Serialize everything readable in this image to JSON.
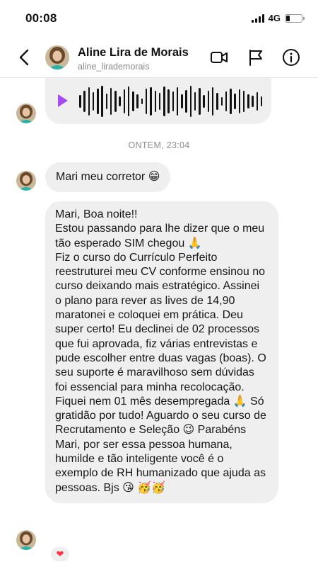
{
  "status_bar": {
    "time": "00:08",
    "network": "4G"
  },
  "header": {
    "contact_name": "Aline Lira de Morais",
    "username": "aline_lirademorais"
  },
  "conversation": {
    "timestamp": "ONTEM, 23:04",
    "messages": [
      {
        "kind": "voice"
      },
      {
        "kind": "text",
        "text": "Mari meu corretor 😁"
      },
      {
        "kind": "text",
        "text": "Mari, Boa noite!!\nEstou passando para lhe dizer que o meu tão esperado SIM chegou 🙏\nFiz o curso do Currículo Perfeito reestruturei meu CV conforme ensinou no curso deixando mais estratégico. Assinei o plano para rever as lives de 14,90 maratonei e coloquei em prática. Deu super certo! Eu declinei de 02 processos que fui aprovada, fiz várias entrevistas e pude escolher entre duas vagas (boas). O seu suporte é maravilhoso sem dúvidas foi essencial para minha recolocação. Fiquei nem 01 mês desempregada 🙏 Só gratidão por tudo! Aguardo o seu curso de Recrutamento e Seleção 😉 Parabéns Mari, por ser essa pessoa humana, humilde e tão inteligente você é o exemplo de RH humanizado que ajuda as pessoas. Bjs 😘 🥳🥳"
      }
    ],
    "reaction": "❤"
  }
}
